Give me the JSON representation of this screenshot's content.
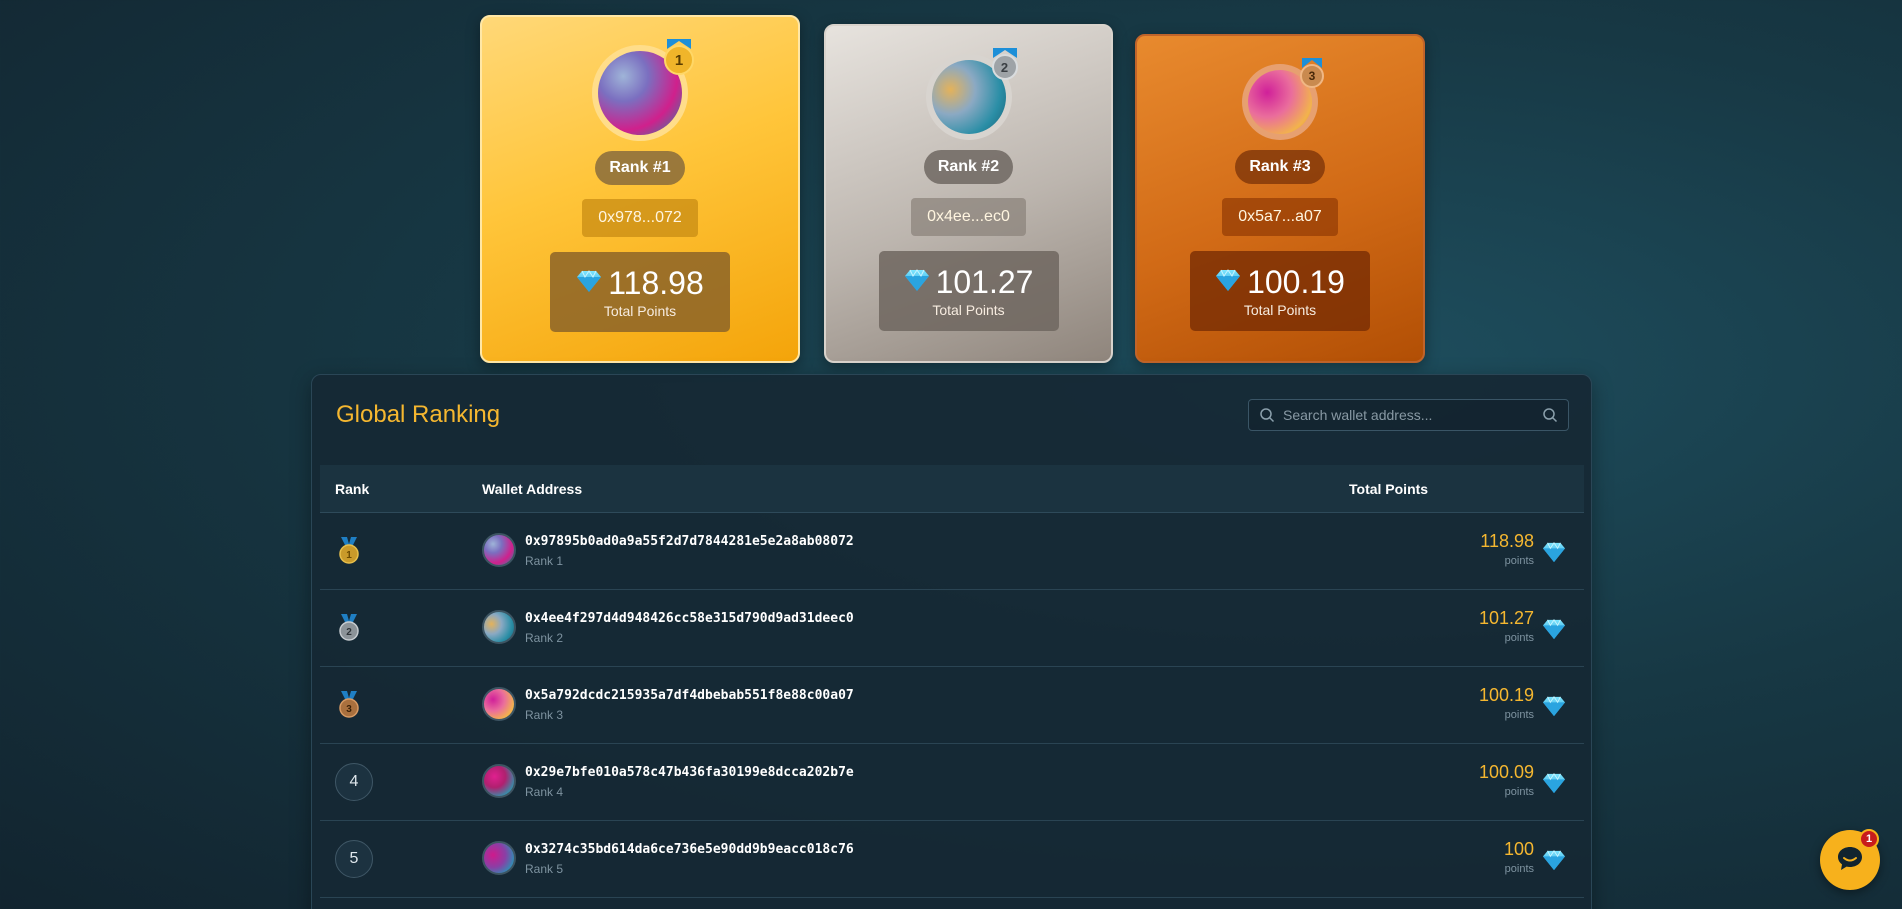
{
  "podium": [
    {
      "rank_label": "Rank #1",
      "medal_number": "1",
      "address": "0x978...072",
      "points": "118.98",
      "points_label": "Total Points"
    },
    {
      "rank_label": "Rank #2",
      "medal_number": "2",
      "address": "0x4ee...ec0",
      "points": "101.27",
      "points_label": "Total Points"
    },
    {
      "rank_label": "Rank #3",
      "medal_number": "3",
      "address": "0x5a7...a07",
      "points": "100.19",
      "points_label": "Total Points"
    }
  ],
  "ranking": {
    "title": "Global Ranking",
    "search_placeholder": "Search wallet address...",
    "columns": {
      "rank": "Rank",
      "wallet": "Wallet Address",
      "points": "Total Points"
    },
    "rows": [
      {
        "rank": "1",
        "medal": "gold",
        "address": "0x97895b0ad0a9a55f2d7d7844281e5e2a8ab08072",
        "sub": "Rank 1",
        "points": "118.98",
        "unit": "points"
      },
      {
        "rank": "2",
        "medal": "silver",
        "address": "0x4ee4f297d4d948426cc58e315d790d9ad31deec0",
        "sub": "Rank 2",
        "points": "101.27",
        "unit": "points"
      },
      {
        "rank": "3",
        "medal": "bronze",
        "address": "0x5a792dcdc215935a7df4dbebab551f8e88c00a07",
        "sub": "Rank 3",
        "points": "100.19",
        "unit": "points"
      },
      {
        "rank": "4",
        "medal": "",
        "address": "0x29e7bfe010a578c47b436fa30199e8dcca202b7e",
        "sub": "Rank 4",
        "points": "100.09",
        "unit": "points"
      },
      {
        "rank": "5",
        "medal": "",
        "address": "0x3274c35bd614da6ce736e5e90dd9b9eacc018c76",
        "sub": "Rank 5",
        "points": "100",
        "unit": "points"
      }
    ]
  },
  "chat": {
    "badge_count": "1"
  },
  "colors": {
    "accent": "#f5b730",
    "gold": "#f4a40a",
    "silver": "#bcb5ae",
    "bronze": "#d16a16",
    "panel": "#162834"
  },
  "icons": {
    "gem": "diamond-icon",
    "search": "search-icon",
    "chat": "chat-icon",
    "medal": "medal-icon"
  }
}
